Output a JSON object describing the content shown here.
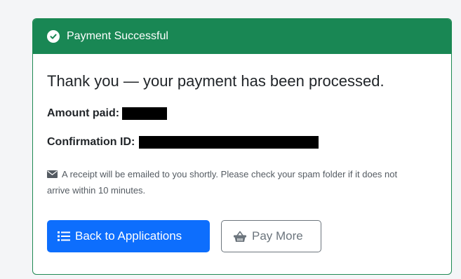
{
  "card": {
    "header_title": "Payment Successful",
    "header_icon": "check-circle-icon",
    "message": "Thank you — your payment has been processed.",
    "amount_label": "Amount paid:",
    "amount_value": "[redacted]",
    "confirmation_label": "Confirmation ID:",
    "confirmation_value": "[redacted]",
    "receipt_note": "A receipt will be emailed to you shortly. Please check your spam folder if it does not arrive within 10 minutes.",
    "receipt_icon": "envelope-icon"
  },
  "actions": {
    "back_label": "Back to Applications",
    "back_icon": "list-icon",
    "pay_more_label": "Pay More",
    "pay_more_icon": "basket-icon"
  },
  "colors": {
    "success": "#198754",
    "primary": "#0d6efd",
    "secondary": "#6c757d"
  }
}
